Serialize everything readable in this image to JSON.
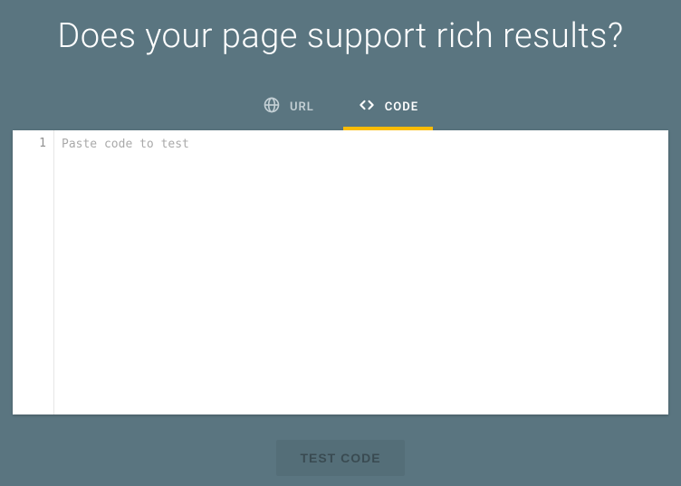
{
  "title": "Does your page support rich results?",
  "tabs": {
    "url": {
      "label": "URL",
      "active": false
    },
    "code": {
      "label": "CODE",
      "active": true
    }
  },
  "editor": {
    "line_number": "1",
    "placeholder": "Paste code to test",
    "value": ""
  },
  "actions": {
    "test_label": "TEST CODE"
  },
  "colors": {
    "background": "#5a7580",
    "accent": "#fbbc04"
  }
}
